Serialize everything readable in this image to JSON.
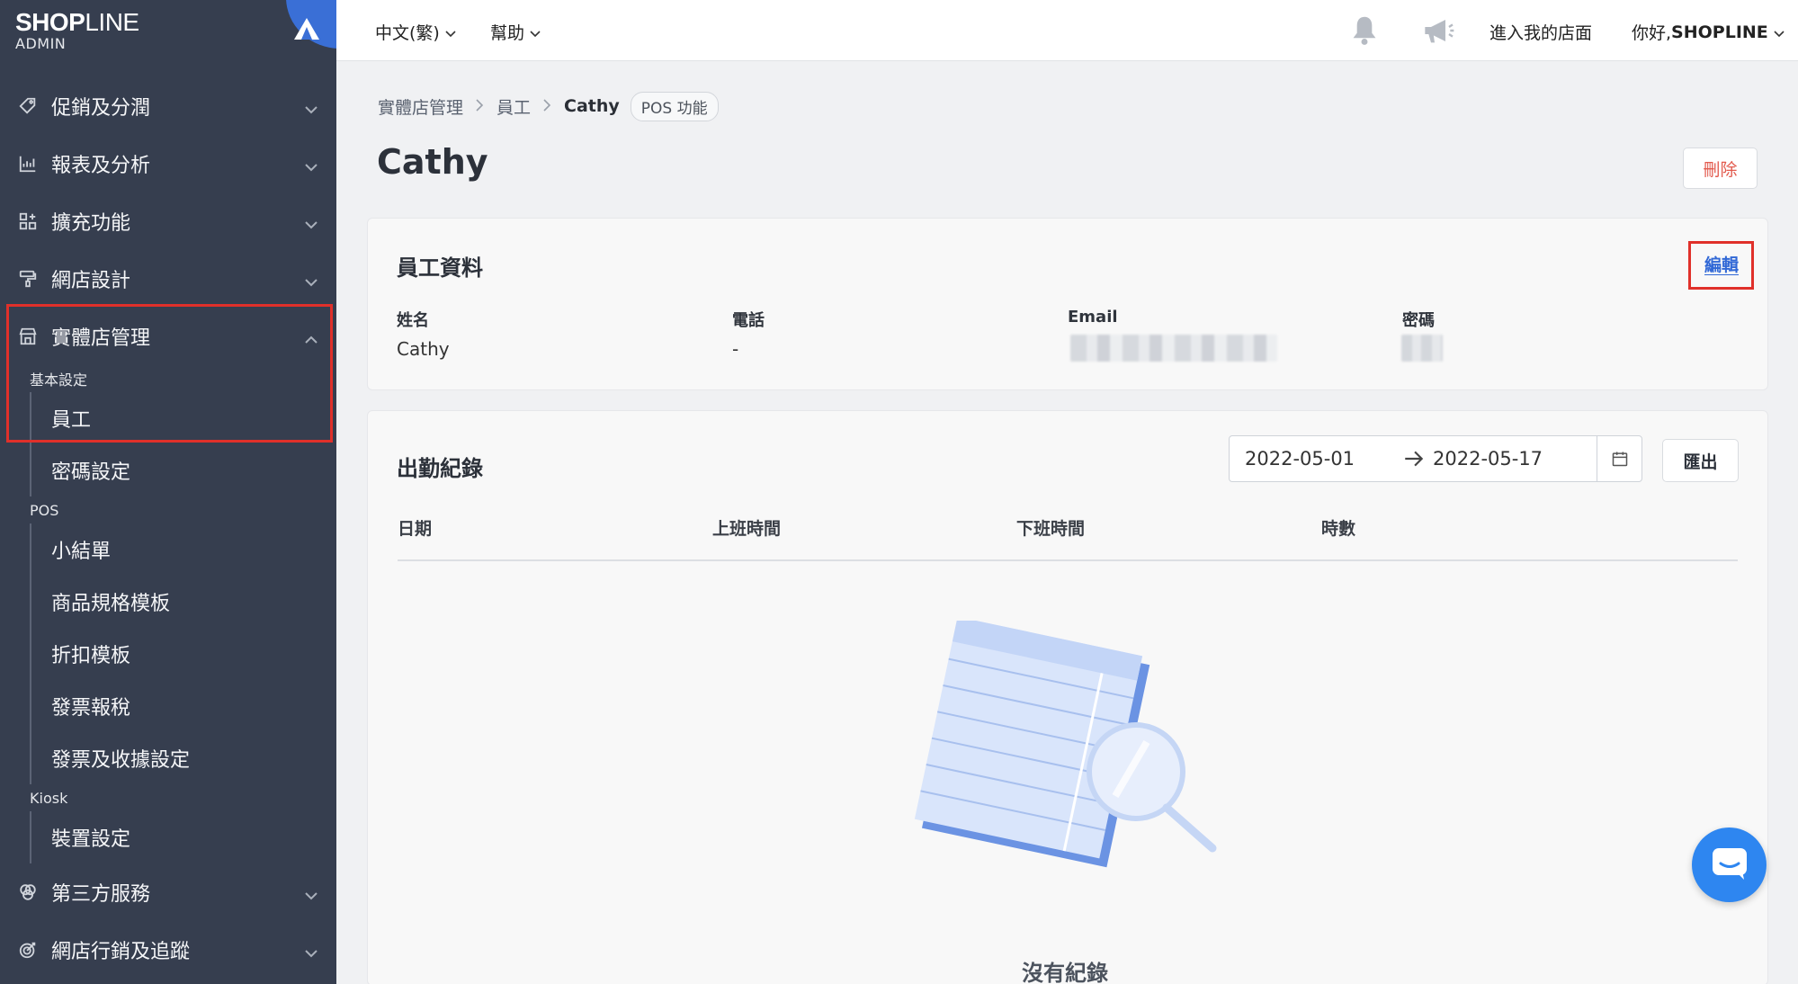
{
  "brand": {
    "name_bold": "SHOP",
    "name_thin": "LINE",
    "sub": "ADMIN"
  },
  "topbar": {
    "language": "中文(繁)",
    "help": "幫助",
    "visit_store": "進入我的店面",
    "greeting_prefix": "你好, ",
    "greeting_name": "SHOPLINE"
  },
  "sidebar": {
    "items": [
      {
        "label": "促銷及分潤",
        "icon": "tag-icon"
      },
      {
        "label": "報表及分析",
        "icon": "chart-icon"
      },
      {
        "label": "擴充功能",
        "icon": "apps-icon"
      },
      {
        "label": "網店設計",
        "icon": "paint-roller-icon"
      },
      {
        "label": "實體店管理",
        "icon": "store-icon"
      }
    ],
    "store_groups": {
      "basic_label": "基本設定",
      "basic_items": [
        "員工",
        "密碼設定"
      ],
      "pos_label": "POS",
      "pos_items": [
        "小結單",
        "商品規格模板",
        "折扣模板",
        "發票報稅",
        "發票及收據設定"
      ],
      "kiosk_label": "Kiosk",
      "kiosk_items": [
        "裝置設定"
      ]
    },
    "bottom_items": [
      {
        "label": "第三方服務",
        "icon": "circles-icon"
      },
      {
        "label": "網店行銷及追蹤",
        "icon": "target-icon"
      }
    ]
  },
  "breadcrumb": {
    "level1": "實體店管理",
    "level2": "員工",
    "current": "Cathy",
    "badge": "POS 功能"
  },
  "page": {
    "title": "Cathy",
    "delete_label": "刪除"
  },
  "employee_card": {
    "title": "員工資料",
    "edit_label": "編輯",
    "fields": {
      "name_label": "姓名",
      "name_value": "Cathy",
      "phone_label": "電話",
      "phone_value": "-",
      "email_label": "Email",
      "password_label": "密碼"
    }
  },
  "attendance": {
    "title": "出勤紀錄",
    "date_from": "2022-05-01",
    "date_to": "2022-05-17",
    "export_label": "匯出",
    "columns": [
      "日期",
      "上班時間",
      "下班時間",
      "時數"
    ],
    "empty_text": "沒有紀錄"
  },
  "colors": {
    "sidebar_bg": "#363e4f",
    "accent": "#3168d6",
    "danger": "#e25a4d",
    "highlight": "#e0302a"
  }
}
